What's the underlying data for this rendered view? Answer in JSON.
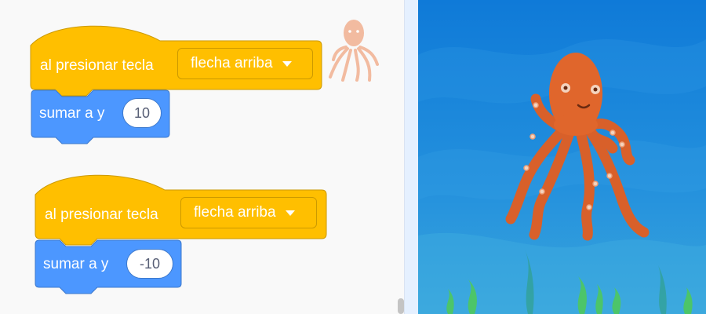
{
  "scripts": [
    {
      "hat": {
        "label": "al presionar tecla",
        "key": "flecha arriba"
      },
      "action": {
        "label": "sumar a y",
        "value": "10"
      }
    },
    {
      "hat": {
        "label": "al presionar tecla",
        "key": "flecha arriba"
      },
      "action": {
        "label": "sumar a y",
        "value": "-10"
      }
    }
  ],
  "sprite": {
    "name": "octopus"
  },
  "colors": {
    "events_block": "#ffbf00",
    "events_border": "#cc9900",
    "motion_block": "#4c97ff",
    "motion_border": "#3d79cc",
    "stage_water": "#1a86dc",
    "octopus": "#e0662c"
  },
  "icons": {
    "dropdown": "caret-down-icon",
    "sprite_thumb": "octopus-icon",
    "seaweed": "seaweed-icon"
  }
}
